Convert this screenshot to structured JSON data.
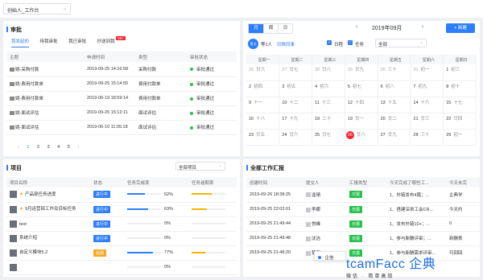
{
  "topbar": {
    "workspace": "创始人_工作台"
  },
  "approval": {
    "title": "审批",
    "tabs": [
      "我发起的",
      "待我审批",
      "我已审批",
      "抄送到我"
    ],
    "badge": "99+",
    "columns": [
      "主题",
      "申请时间",
      "类型",
      "审批状态"
    ],
    "rows": [
      {
        "subject": "姚-采购付款",
        "time": "2019-09-25 14:16:58",
        "type": "采购付款",
        "status": "审批通过"
      },
      {
        "subject": "姚-费用付款单",
        "time": "2019-09-25 15:14:55",
        "type": "费用付款单",
        "status": "审批通过"
      },
      {
        "subject": "姚-费用付款单",
        "time": "2019-06-19 18:59:14",
        "type": "费用付款单",
        "status": "审批通过"
      },
      {
        "subject": "姚-面试评估",
        "time": "2019-09-25 15:12:11",
        "type": "面试评估",
        "status": "审批通过"
      },
      {
        "subject": "姚-面试评估",
        "time": "2019-06-10 11:05:18",
        "type": "面试评估",
        "status": "审批通过"
      }
    ],
    "pager": [
      "1",
      "2",
      "3",
      "4",
      "5"
    ]
  },
  "calendar": {
    "views": [
      "月",
      "周",
      "日"
    ],
    "month": "2019年09月",
    "new_label": "+ 新建",
    "user_label": "用卡",
    "user_name": "等1人",
    "switch_label": "切换同事",
    "filters": [
      "日程",
      "任务"
    ],
    "select": "全部",
    "weekdays": [
      "星期一",
      "星期二",
      "星期三",
      "星期四",
      "星期五",
      "星期六",
      "星期日"
    ],
    "weeks": [
      [
        [
          "26",
          "廿六"
        ],
        [
          "27",
          "廿七"
        ],
        [
          "28",
          "廿八"
        ],
        [
          "29",
          "廿九"
        ],
        [
          "30",
          "三十"
        ],
        [
          "31",
          "初一"
        ],
        [
          "1",
          "初三"
        ]
      ],
      [
        [
          "2",
          "初四"
        ],
        [
          "3",
          "初五"
        ],
        [
          "4",
          "初六"
        ],
        [
          "5",
          "初七"
        ],
        [
          "6",
          "初八"
        ],
        [
          "7",
          "初九"
        ],
        [
          "8",
          "初十"
        ]
      ],
      [
        [
          "9",
          "十一"
        ],
        [
          "10",
          "十二"
        ],
        [
          "11",
          "十三"
        ],
        [
          "12",
          "十四"
        ],
        [
          "13",
          "十五"
        ],
        [
          "14",
          "十六"
        ],
        [
          "15",
          "十七"
        ]
      ],
      [
        [
          "16",
          "十八"
        ],
        [
          "17",
          "十九"
        ],
        [
          "18",
          "二十"
        ],
        [
          "19",
          "廿一"
        ],
        [
          "20",
          "廿二"
        ],
        [
          "21",
          "廿三"
        ],
        [
          "22",
          "廿四"
        ]
      ],
      [
        [
          "23",
          "廿五"
        ],
        [
          "24",
          "廿六"
        ],
        [
          "25",
          "廿七"
        ],
        [
          "26",
          "廿八"
        ],
        [
          "27",
          "廿九"
        ],
        [
          "28",
          "三十"
        ],
        [
          "29",
          "初一"
        ]
      ]
    ],
    "today": "26"
  },
  "projects": {
    "title": "项目",
    "select": "全部项目",
    "columns": [
      "项目名称",
      "状态",
      "任务完成率",
      "任务逾期率"
    ],
    "rows": [
      {
        "name": "产品部任务进度",
        "star": true,
        "status": "进行中",
        "color": "#2d7ff9",
        "done": "52%",
        "done_v": 0.52,
        "overdue_v": 0.6
      },
      {
        "name": "9月运营部工作及目标任务",
        "star": true,
        "status": "进行中",
        "color": "#2d7ff9",
        "done": "63%",
        "done_v": 0.63,
        "overdue_v": 0.45
      },
      {
        "name": "test",
        "star": false,
        "status": "进行中",
        "color": "#2d7ff9",
        "done": "0%",
        "done_v": 0,
        "overdue_v": 0
      },
      {
        "name": "系统介绍",
        "star": false,
        "status": "进行中",
        "color": "#2d7ff9",
        "done": "0%",
        "done_v": 0,
        "overdue_v": 0
      },
      {
        "name": "自定义模块5.2",
        "star": false,
        "status": "延期",
        "color": "#f5a623",
        "done": "77%",
        "done_v": 0.77,
        "overdue_v": 0.4
      },
      {
        "name": "",
        "star": false,
        "status": "",
        "color": "#2d7ff9",
        "done": "0%",
        "done_v": 0,
        "overdue_v": 0
      }
    ]
  },
  "reports": {
    "title": "全部工作汇报",
    "columns": [
      "创建时间",
      "提交人",
      "汇报类型",
      "今天完成了哪些工...",
      "今天未完"
    ],
    "rows": [
      {
        "time": "2019-09-26 18:38:25",
        "user": "逢晴",
        "type": "日报",
        "done": "1、外链发布4篇；...",
        "todo": "企典学"
      },
      {
        "time": "2019-09-25 22:02:01",
        "user": "李娜",
        "type": "日报",
        "done": "1、搭建深圳工会CR...",
        "todo": "今天约"
      },
      {
        "time": "2019-09-25 21:49:44",
        "user": "悦峰",
        "type": "日报",
        "done": "1、发布外链10+；...",
        "todo": "0"
      },
      {
        "time": "2019-09-25 21:49:48",
        "user": "沈洁",
        "type": "日报",
        "done": "1、参与新酬评审；...",
        "todo": "新酬表"
      },
      {
        "time": "2019-09-25 21:48:20",
        "user": "楚颜",
        "type": "日报",
        "done": "1、参与新酬需求评审...",
        "todo": "可回回"
      }
    ]
  },
  "chat": {
    "label": "企信"
  },
  "watermark": {
    "brand": "tcamFacc 企典",
    "slogan": "微信 · 简单高效"
  }
}
